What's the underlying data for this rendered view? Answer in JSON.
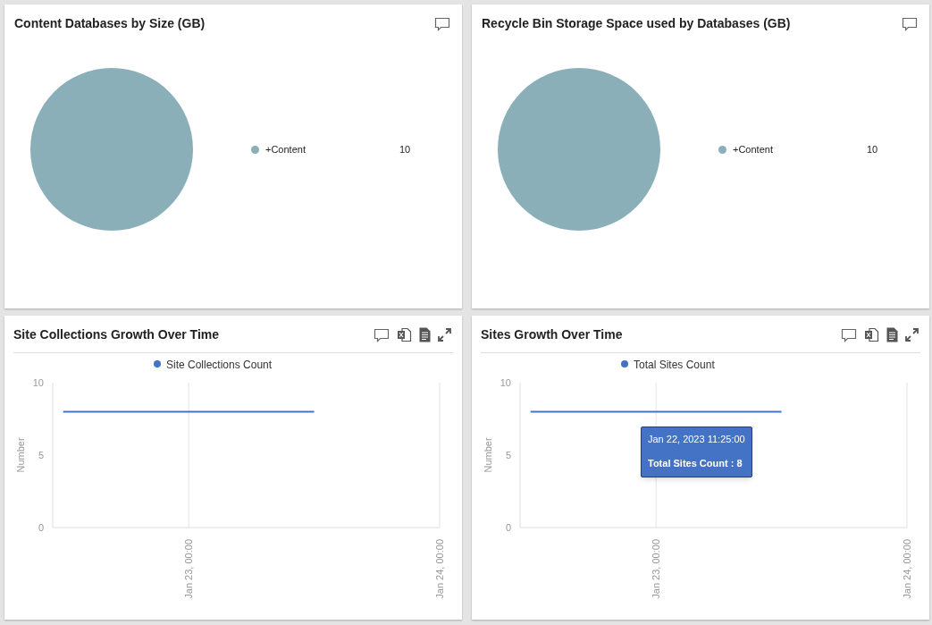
{
  "panels": [
    {
      "title": "Content Databases by Size (GB)",
      "chart_data": {
        "type": "pie",
        "categories": [
          "+Content"
        ],
        "values": [
          100
        ]
      },
      "legend_values": [
        "10"
      ]
    },
    {
      "title": "Recycle Bin Storage Space used by Databases (GB)",
      "chart_data": {
        "type": "pie",
        "categories": [
          "+Content"
        ],
        "values": [
          100
        ]
      },
      "legend_values": [
        "10"
      ]
    },
    {
      "title": "Site Collections Growth Over Time",
      "chart_data": {
        "type": "line",
        "ylabel": "Number",
        "categories": [
          null,
          "Jan 23, 00:00",
          null,
          "Jan 24, 00:00"
        ],
        "ylim": [
          0,
          10
        ],
        "yticks": [
          0,
          5,
          10
        ],
        "series": [
          {
            "name": "Site Collections Count",
            "color": "#4472c4",
            "values": [
              8,
              8,
              8,
              null
            ]
          }
        ]
      }
    },
    {
      "title": "Sites Growth Over Time",
      "chart_data": {
        "type": "line",
        "ylabel": "Number",
        "categories": [
          null,
          "Jan 23, 00:00",
          null,
          "Jan 24, 00:00"
        ],
        "ylim": [
          0,
          10
        ],
        "yticks": [
          0,
          5,
          10
        ],
        "series": [
          {
            "name": "Total Sites Count",
            "color": "#4472c4",
            "values": [
              8,
              8,
              8,
              null
            ]
          }
        ]
      },
      "tooltip": {
        "date": "Jan 22, 2023 11:25:00",
        "value": "Total Sites Count : 8"
      }
    }
  ]
}
